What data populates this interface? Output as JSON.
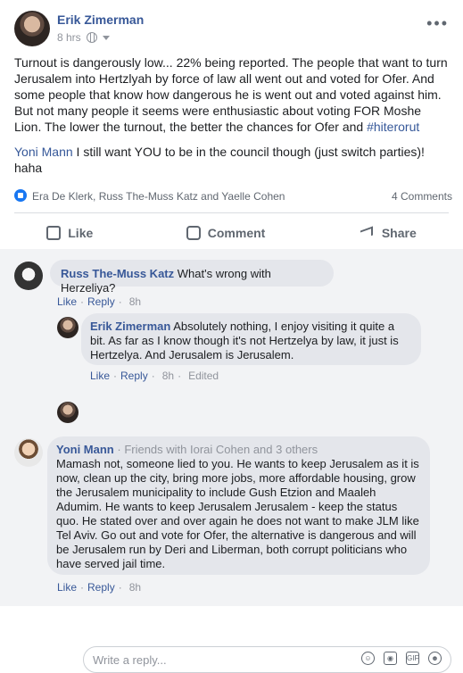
{
  "post": {
    "author": "Erik Zimerman",
    "time": "8 hrs",
    "more_label": "•••",
    "text_main": "Turnout is dangerously low... 22% being reported. The people that want to turn Jerusalem into Hertzlyah by force of law all went out and voted for Ofer. And some people that know how dangerous he is went out and voted against him. But not many people it seems were enthusiastic about voting FOR Moshe Lion. The lower the turnout, the better the chances for Ofer and ",
    "hashtag": "#hiterorut",
    "mention_name": "Yoni Mann",
    "mention_text": " I still want YOU to be in the council though (just switch parties)! haha"
  },
  "reactions": {
    "names": "Era De Klerk, Russ The-Muss Katz and Yaelle Cohen",
    "comment_count": "4 Comments"
  },
  "actions": {
    "like": "Like",
    "comment": "Comment",
    "share": "Share"
  },
  "comments": [
    {
      "name": "Russ The-Muss Katz",
      "text": " What's wrong with Herzeliya?",
      "like": "Like",
      "reply": "Reply",
      "time": "8h"
    },
    {
      "name": "Erik Zimerman",
      "text": " Absolutely nothing, I enjoy visiting it quite a bit. As far as I know though it's not Hertzelya by law, it just is Hertzelya. And Jerusalem is Jerusalem.",
      "like": "Like",
      "reply": "Reply",
      "time": "8h",
      "edited": "Edited"
    },
    {
      "name": "Yoni Mann",
      "friends": " · Friends with Iorai Cohen and 3 others",
      "text": "Mamash not, someone lied to you. He wants to keep Jerusalem as it is now, clean up the city, bring more jobs, more affordable housing, grow the Jerusalem municipality to include Gush Etzion and Maaleh Adumim. He wants to keep Jerusalem Jerusalem - keep the status quo. He stated over and over again he does not want to make JLM like Tel Aviv. Go out and vote for Ofer, the alternative is dangerous and will be Jerusalem run by Deri and Liberman, both corrupt politicians who have served jail time.",
      "like": "Like",
      "reply": "Reply",
      "time": "8h"
    }
  ],
  "reply_box": {
    "placeholder": "Write a reply...",
    "icons": [
      "emoji-icon",
      "camera-icon",
      "gif-icon",
      "sticker-icon"
    ]
  },
  "colors": {
    "link_blue": "#385898",
    "facebook_blue": "#1877f2",
    "background": "#f2f3f5"
  }
}
